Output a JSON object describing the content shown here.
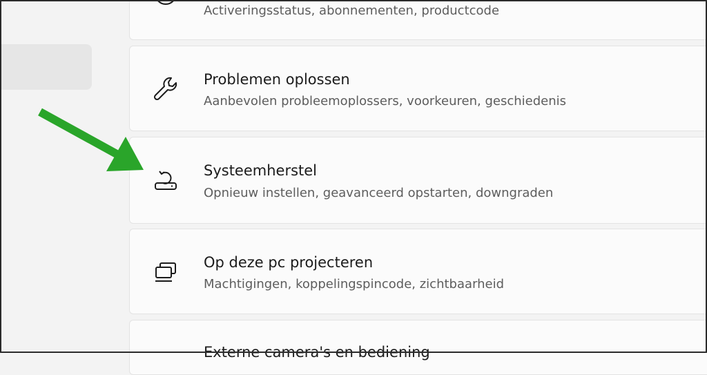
{
  "colors": {
    "background": "#f3f3f3",
    "card": "#fbfbfb",
    "sidebar_selected": "#e6e6e6",
    "annotation_arrow": "#2aa52a"
  },
  "sidebar": {
    "selected_item_label": ""
  },
  "settings": [
    {
      "icon": "activation-icon",
      "title": "",
      "subtitle": "Activeringsstatus, abonnementen, productcode"
    },
    {
      "icon": "wrench-icon",
      "title": "Problemen oplossen",
      "subtitle": "Aanbevolen probleemoplossers, voorkeuren, geschiedenis"
    },
    {
      "icon": "recovery-icon",
      "title": "Systeemherstel",
      "subtitle": "Opnieuw instellen, geavanceerd opstarten, downgraden"
    },
    {
      "icon": "projecting-icon",
      "title": "Op deze pc projecteren",
      "subtitle": "Machtigingen, koppelingspincode, zichtbaarheid"
    },
    {
      "icon": "",
      "title": "Externe camera's en bediening",
      "subtitle": ""
    }
  ],
  "annotation": {
    "icon": "green-arrow-icon"
  }
}
